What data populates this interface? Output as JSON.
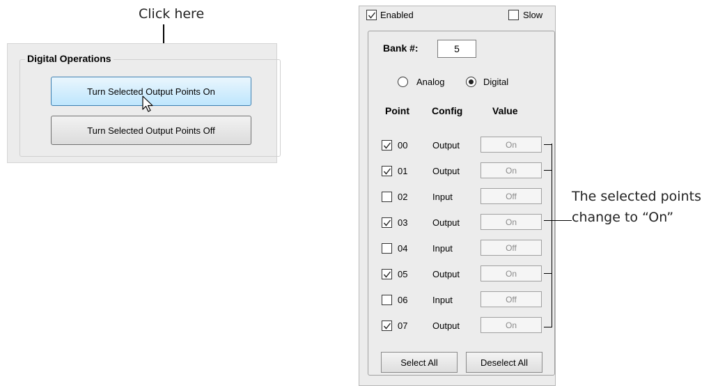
{
  "annotations": {
    "click_here": "Click here",
    "selected_line1": "The selected points",
    "selected_line2": "change to “On”"
  },
  "digital_operations": {
    "title": "Digital Operations",
    "turn_on_label": "Turn Selected Output Points On",
    "turn_off_label": "Turn Selected Output Points Off"
  },
  "bank_panel": {
    "enabled_label": "Enabled",
    "enabled_checked": true,
    "slow_label": "Slow",
    "slow_checked": false,
    "bank_label": "Bank #:",
    "bank_value": "5",
    "analog_label": "Analog",
    "digital_label": "Digital",
    "selected_mode": "Digital",
    "headers": {
      "point": "Point",
      "config": "Config",
      "value": "Value"
    },
    "rows": [
      {
        "point": "00",
        "config": "Output",
        "value": "On",
        "checked": true
      },
      {
        "point": "01",
        "config": "Output",
        "value": "On",
        "checked": true
      },
      {
        "point": "02",
        "config": "Input",
        "value": "Off",
        "checked": false
      },
      {
        "point": "03",
        "config": "Output",
        "value": "On",
        "checked": true
      },
      {
        "point": "04",
        "config": "Input",
        "value": "Off",
        "checked": false
      },
      {
        "point": "05",
        "config": "Output",
        "value": "On",
        "checked": true
      },
      {
        "point": "06",
        "config": "Input",
        "value": "Off",
        "checked": false
      },
      {
        "point": "07",
        "config": "Output",
        "value": "On",
        "checked": true
      }
    ],
    "select_all_label": "Select All",
    "deselect_all_label": "Deselect All"
  }
}
